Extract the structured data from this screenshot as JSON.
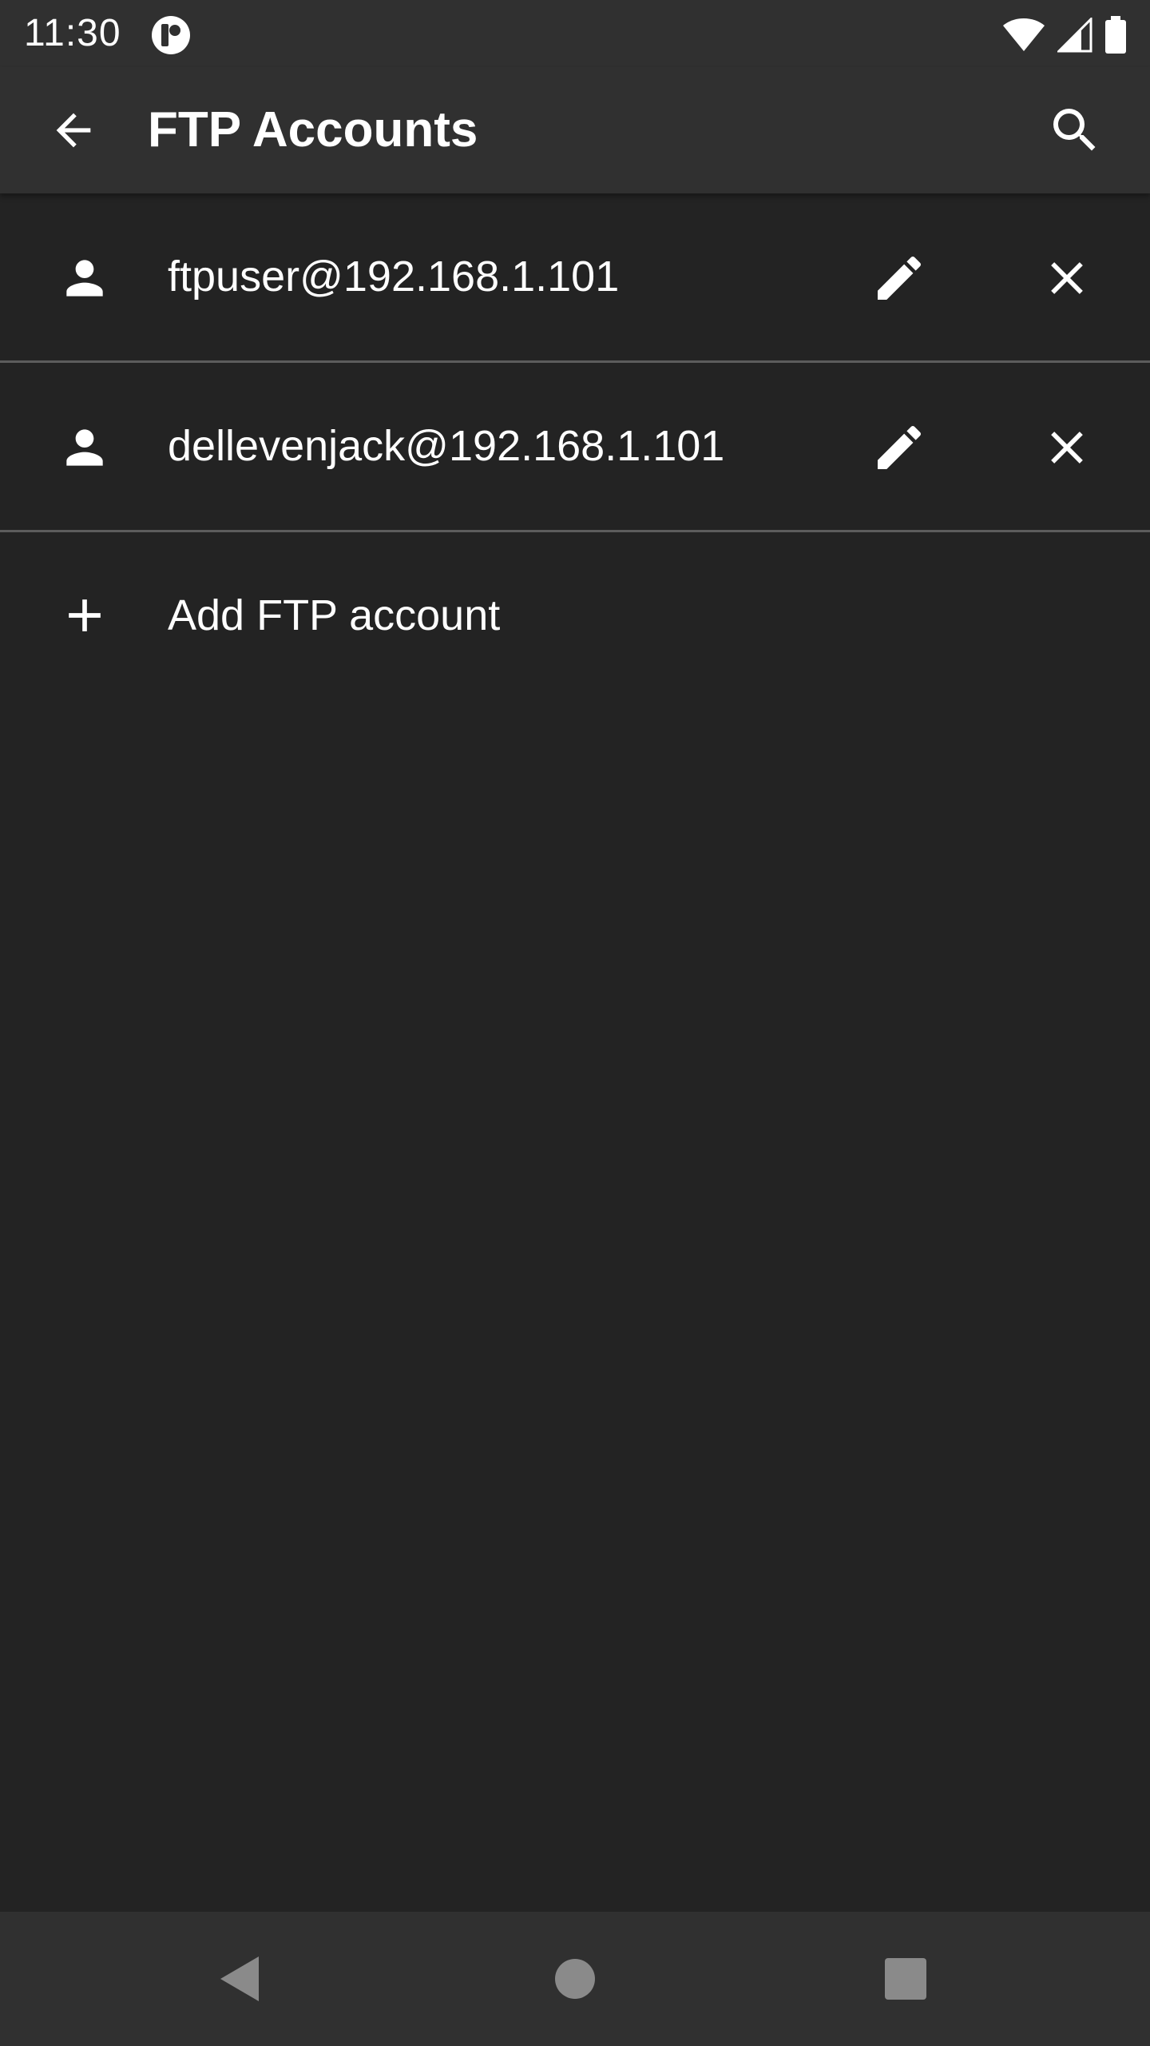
{
  "status_bar": {
    "time": "11:30"
  },
  "toolbar": {
    "title": "FTP Accounts"
  },
  "accounts": [
    {
      "label": "ftpuser@192.168.1.101"
    },
    {
      "label": "dellevenjack@192.168.1.101"
    }
  ],
  "add_account": {
    "label": "Add FTP account"
  },
  "icons": {
    "back": "arrow-back-icon",
    "search": "search-icon",
    "user": "person-icon",
    "edit": "pencil-icon",
    "delete": "close-icon",
    "add": "plus-icon"
  },
  "colors": {
    "background": "#232323",
    "bars": "#303030",
    "divider": "#5c5c5c",
    "text": "#ffffff",
    "nav_icons": "#8a8a8a"
  }
}
